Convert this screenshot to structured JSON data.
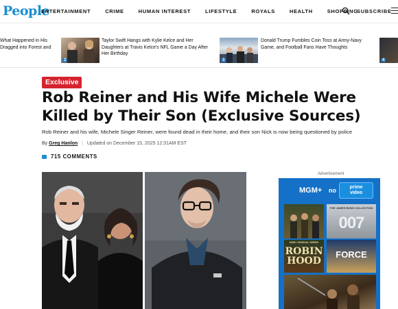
{
  "brand": {
    "logo": "People",
    "color": "#1b8fd0"
  },
  "nav": {
    "links": [
      "ENTERTAINMENT",
      "CRIME",
      "HUMAN INTEREST",
      "LIFESTYLE",
      "ROYALS",
      "HEALTH",
      "SHOPPING"
    ],
    "subscribe": "SUBSCRIBE",
    "icons": [
      "search-icon",
      "menu-icon"
    ]
  },
  "trending": [
    {
      "num": "",
      "text": "What Happened in His Dragged into Forest and"
    },
    {
      "num": "2",
      "text": "Taylor Swift Hangs with Kylie Kelce and Her Daughters at Travis Kelce's NFL Game a Day After Her Birthday"
    },
    {
      "num": "3",
      "text": "Donald Trump Fumbles Coin Toss at Army-Navy Game, and Football Fans Have Thoughts"
    },
    {
      "num": "4",
      "text": ""
    }
  ],
  "article": {
    "tag": "Exclusive",
    "headline": "Rob Reiner and His Wife Michele Were Killed by Their Son (Exclusive Sources)",
    "dek": "Rob Reiner and his wife, Michele Singer Reiner, were found dead in their home, and their son Nick is now being questioned by police",
    "by": "By",
    "author": "Greg Hanlon",
    "updated": "Updated on December 15, 2025 12:31AM EST",
    "comments": "715 COMMENTS"
  },
  "ad": {
    "label": "Advertisement",
    "brand": "MGM+",
    "no": "no",
    "prime_line1": "prime",
    "prime_line2": "video",
    "posters": [
      "THE JAMES BOND COLLECTION",
      "007",
      "MGM+ ORIGINAL SERIES",
      "ROBIN HOOD",
      "FORCE"
    ]
  },
  "colors": {
    "accent_red": "#d6232e",
    "accent_blue": "#1b8fd0",
    "ad_blue": "#1471c7"
  }
}
